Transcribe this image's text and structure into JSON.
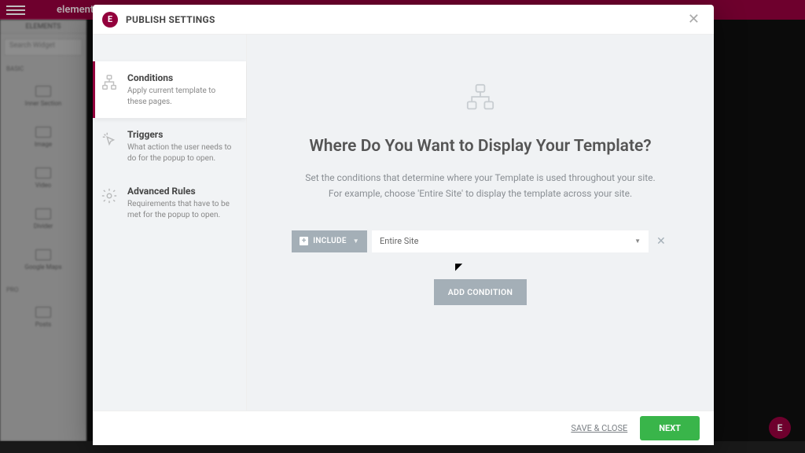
{
  "bg": {
    "brand": "elementor",
    "sidebar_tab": "ELEMENTS",
    "search_placeholder": "Search Widget",
    "section_basic": "Basic",
    "section_pro": "Pro",
    "widgets": {
      "inner_section": "Inner Section",
      "image": "Image",
      "video": "Video",
      "divider": "Divider",
      "google_maps": "Google Maps",
      "posts": "Posts"
    }
  },
  "modal": {
    "title": "PUBLISH SETTINGS",
    "icon_letter": "E",
    "nav": {
      "conditions": {
        "title": "Conditions",
        "desc": "Apply current template to these pages."
      },
      "triggers": {
        "title": "Triggers",
        "desc": "What action the user needs to do for the popup to open."
      },
      "advanced": {
        "title": "Advanced Rules",
        "desc": "Requirements that have to be met for the popup to open."
      }
    },
    "main": {
      "heading": "Where Do You Want to Display Your Template?",
      "sub1": "Set the conditions that determine where your Template is used throughout your site.",
      "sub2": "For example, choose 'Entire Site' to display the template across your site.",
      "include_label": "INCLUDE",
      "condition_value": "Entire Site",
      "add_label": "ADD CONDITION"
    },
    "footer": {
      "save_close": "SAVE & CLOSE",
      "next": "NEXT"
    }
  }
}
